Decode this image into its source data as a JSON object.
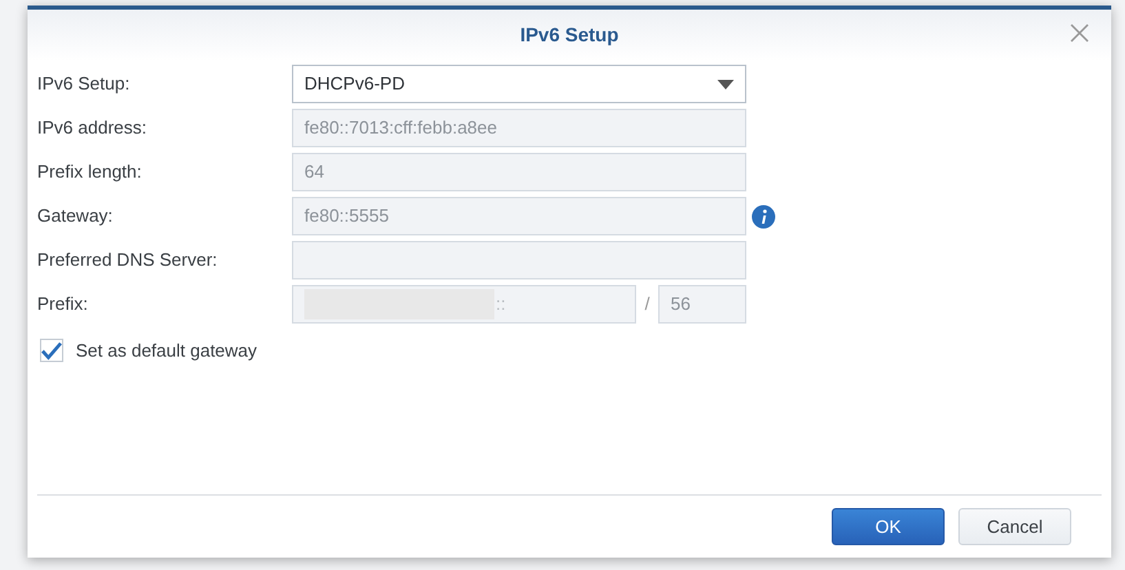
{
  "dialog": {
    "title": "IPv6 Setup"
  },
  "fields": [
    {
      "kind": "select",
      "label": "IPv6 Setup:",
      "value": "DHCPv6-PD",
      "disabled": false,
      "info": false
    },
    {
      "kind": "text",
      "label": "IPv6 address:",
      "value": "fe80::7013:cff:febb:a8ee",
      "disabled": true,
      "info": false
    },
    {
      "kind": "text",
      "label": "Prefix length:",
      "value": "64",
      "disabled": true,
      "info": false
    },
    {
      "kind": "text",
      "label": "Gateway:",
      "value": "fe80::5555",
      "disabled": true,
      "info": true
    },
    {
      "kind": "text",
      "label": "Preferred DNS Server:",
      "disabled": true,
      "info": false
    },
    {
      "kind": "prefix",
      "label": "Prefix:",
      "value": "::",
      "separator": "/",
      "length": "56",
      "disabled": true,
      "info": false
    }
  ],
  "checkbox": {
    "label": "Set as default gateway",
    "checked": true
  },
  "buttons": [
    {
      "kind": "primary",
      "label": "OK"
    },
    {
      "kind": "default",
      "label": "Cancel"
    }
  ]
}
